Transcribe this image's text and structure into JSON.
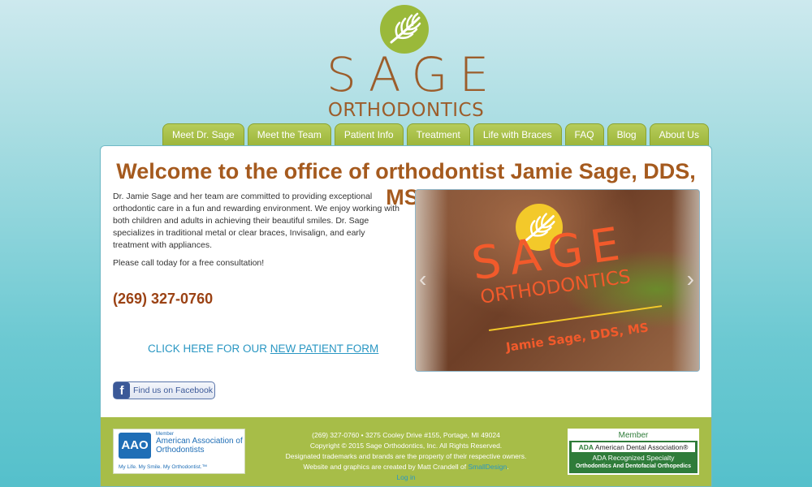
{
  "logo": {
    "title": "SAGE",
    "subtitle": "ORTHODONTICS",
    "brand_green": "#9ab93a",
    "brand_brown": "#9c5d2b"
  },
  "nav": {
    "items": [
      {
        "label": "Meet Dr. Sage"
      },
      {
        "label": "Meet the Team"
      },
      {
        "label": "Patient Info"
      },
      {
        "label": "Treatment"
      },
      {
        "label": "Life with Braces"
      },
      {
        "label": "FAQ"
      },
      {
        "label": "Blog"
      },
      {
        "label": "About Us"
      }
    ]
  },
  "main": {
    "heading": "Welcome to the office of orthodontist Jamie Sage, DDS, MS!",
    "intro_paragraph": "Dr. Jamie Sage and her team are committed to providing exceptional orthodontic care in a fun and rewarding environment. We enjoy working with both children and adults in achieving their beautiful smiles. Dr. Sage specializes in traditional metal or clear braces, Invisalign, and early treatment with appliances.",
    "call_text": "Please call today for a free consultation!",
    "phone": "(269) 327-0760",
    "form_prefix": "CLICK HERE FOR OUR",
    "form_link": "NEW PATIENT FORM",
    "facebook_label": "Find us on Facebook",
    "facebook_icon": "facebook-icon"
  },
  "slideshow": {
    "sign_title": "SAGE",
    "sign_subtitle": "ORTHODONTICS",
    "sign_name": "Jamie Sage, DDS, MS",
    "prev_arrow": "‹",
    "next_arrow": "›"
  },
  "footer": {
    "aao": {
      "logo_text": "AAO",
      "member": "Member",
      "name": "American Association of Orthodontists",
      "tagline": "My Life. My Smile. My Orthodontist.™"
    },
    "contact": "(269) 327-0760 • 3275 Cooley Drive #155, Portage, MI 49024",
    "copyright": "Copyright © 2015 Sage Orthodontics, Inc. All Rights Reserved.",
    "trademarks": "Designated trademarks and brands are the property of their respective owners.",
    "credit_prefix": "Website and graphics are created by Matt Crandell of",
    "credit_link": "SmallDesign",
    "credit_suffix": ".",
    "login": "Log in",
    "ada": {
      "member": "Member",
      "abbr": "ADA",
      "assoc": "American Dental Association®",
      "recognized": "ADA Recognized Specialty",
      "specialty": "Orthodontics And Dentofacial Orthopedics"
    }
  }
}
